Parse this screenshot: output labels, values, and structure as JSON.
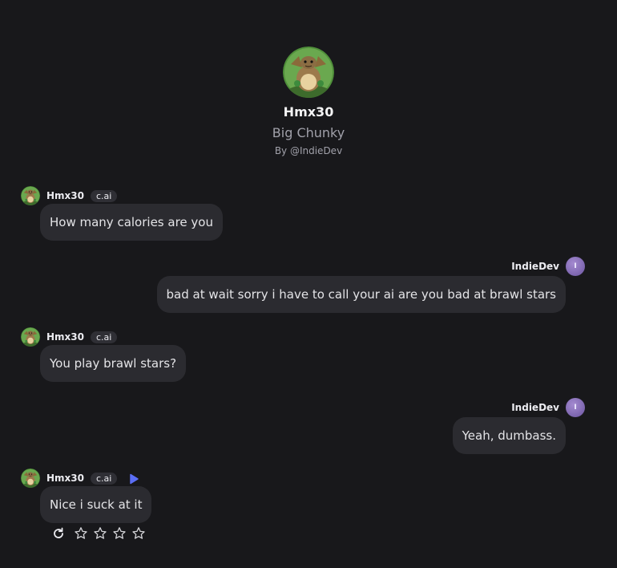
{
  "character": {
    "name": "Hmx30",
    "title": "Big Chunky",
    "creator": "By @IndieDev",
    "avatar_icon": "dragon-character-avatar"
  },
  "messages": [
    {
      "role": "bot",
      "sender": "Hmx30",
      "badge": "c.ai",
      "text": "How many calories are you"
    },
    {
      "role": "user",
      "sender": "IndieDev",
      "avatar_letter": "I",
      "text": "bad at wait sorry i have to call your ai are you bad at brawl stars"
    },
    {
      "role": "bot",
      "sender": "Hmx30",
      "badge": "c.ai",
      "text": "You play brawl stars?"
    },
    {
      "role": "user",
      "sender": "IndieDev",
      "avatar_letter": "I",
      "text": "Yeah, dumbass."
    },
    {
      "role": "bot",
      "sender": "Hmx30",
      "badge": "c.ai",
      "text": "Nice i suck at it",
      "has_play": true
    }
  ],
  "rating": {
    "stars": 4,
    "icons": [
      "refresh-icon",
      "star-icon"
    ]
  },
  "colors": {
    "background": "#18181b",
    "bubble": "#2b2b30",
    "play_accent": "#5b6ef5",
    "user_avatar": "#8a6fc0"
  }
}
